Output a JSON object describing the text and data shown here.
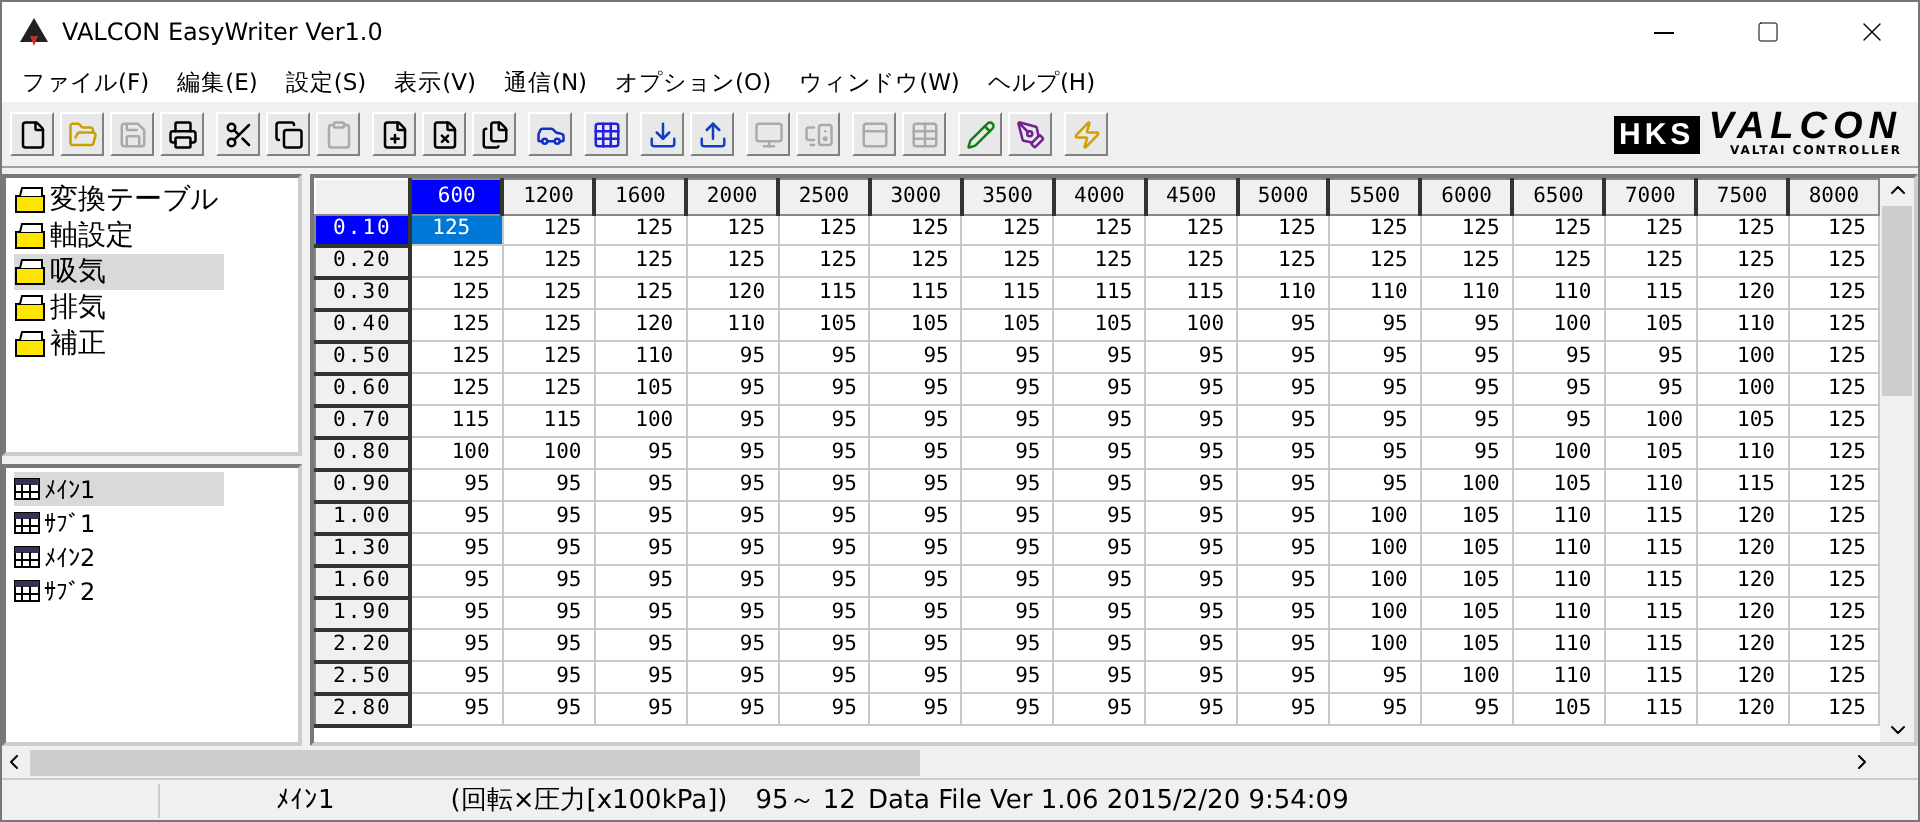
{
  "window": {
    "title": "VALCON EasyWriter Ver1.0"
  },
  "menu": [
    "ファイル(F)",
    "編集(E)",
    "設定(S)",
    "表示(V)",
    "通信(N)",
    "オプション(O)",
    "ウィンドウ(W)",
    "ヘルプ(H)"
  ],
  "toolbar_groups": [
    [
      {
        "disabled": false
      },
      {
        "disabled": false
      },
      {
        "disabled": true
      },
      {
        "disabled": false
      }
    ],
    [
      {
        "disabled": false
      },
      {
        "disabled": false
      },
      {
        "disabled": true
      }
    ],
    [
      {
        "disabled": false
      },
      {
        "disabled": false
      },
      {
        "disabled": false
      }
    ],
    [
      {
        "disabled": false
      }
    ],
    [
      {
        "disabled": false
      }
    ],
    [
      {
        "disabled": false
      },
      {
        "disabled": false
      }
    ],
    [
      {
        "disabled": true
      },
      {
        "disabled": true
      }
    ],
    [
      {
        "disabled": true
      },
      {
        "disabled": true
      }
    ],
    [
      {
        "disabled": false
      },
      {
        "disabled": false
      }
    ],
    [
      {
        "disabled": false
      }
    ]
  ],
  "logo": {
    "brand": "HKS",
    "product": "VALCON",
    "tagline": "VALTAI CONTROLLER"
  },
  "categories": [
    {
      "label": "変換テーブル",
      "selected": false
    },
    {
      "label": "軸設定",
      "selected": false
    },
    {
      "label": "吸気",
      "selected": true
    },
    {
      "label": "排気",
      "selected": false
    },
    {
      "label": "補正",
      "selected": false
    }
  ],
  "maps": [
    {
      "label": "ﾒｲﾝ1",
      "selected": true
    },
    {
      "label": "ｻﾌﾞ1",
      "selected": false
    },
    {
      "label": "ﾒｲﾝ2",
      "selected": false
    },
    {
      "label": "ｻﾌﾞ2",
      "selected": false
    }
  ],
  "table": {
    "columns": [
      {
        "label": "600",
        "selected": true
      },
      {
        "label": "1200",
        "selected": false
      },
      {
        "label": "1600",
        "selected": false
      },
      {
        "label": "2000",
        "selected": false
      },
      {
        "label": "2500",
        "selected": false
      },
      {
        "label": "3000",
        "selected": false
      },
      {
        "label": "3500",
        "selected": false
      },
      {
        "label": "4000",
        "selected": false
      },
      {
        "label": "4500",
        "selected": false
      },
      {
        "label": "5000",
        "selected": false
      },
      {
        "label": "5500",
        "selected": false
      },
      {
        "label": "6000",
        "selected": false
      },
      {
        "label": "6500",
        "selected": false
      },
      {
        "label": "7000",
        "selected": false
      },
      {
        "label": "7500",
        "selected": false
      },
      {
        "label": "8000",
        "selected": false
      }
    ],
    "rows": [
      {
        "label": "0.10",
        "selected": true,
        "cells": [
          {
            "value": "125",
            "selected": true
          },
          {
            "value": "125",
            "selected": false
          },
          {
            "value": "125",
            "selected": false
          },
          {
            "value": "125",
            "selected": false
          },
          {
            "value": "125",
            "selected": false
          },
          {
            "value": "125",
            "selected": false
          },
          {
            "value": "125",
            "selected": false
          },
          {
            "value": "125",
            "selected": false
          },
          {
            "value": "125",
            "selected": false
          },
          {
            "value": "125",
            "selected": false
          },
          {
            "value": "125",
            "selected": false
          },
          {
            "value": "125",
            "selected": false
          },
          {
            "value": "125",
            "selected": false
          },
          {
            "value": "125",
            "selected": false
          },
          {
            "value": "125",
            "selected": false
          },
          {
            "value": "125",
            "selected": false
          }
        ]
      },
      {
        "label": "0.20",
        "selected": false,
        "cells": [
          {
            "value": "125",
            "selected": false
          },
          {
            "value": "125",
            "selected": false
          },
          {
            "value": "125",
            "selected": false
          },
          {
            "value": "125",
            "selected": false
          },
          {
            "value": "125",
            "selected": false
          },
          {
            "value": "125",
            "selected": false
          },
          {
            "value": "125",
            "selected": false
          },
          {
            "value": "125",
            "selected": false
          },
          {
            "value": "125",
            "selected": false
          },
          {
            "value": "125",
            "selected": false
          },
          {
            "value": "125",
            "selected": false
          },
          {
            "value": "125",
            "selected": false
          },
          {
            "value": "125",
            "selected": false
          },
          {
            "value": "125",
            "selected": false
          },
          {
            "value": "125",
            "selected": false
          },
          {
            "value": "125",
            "selected": false
          }
        ]
      },
      {
        "label": "0.30",
        "selected": false,
        "cells": [
          {
            "value": "125",
            "selected": false
          },
          {
            "value": "125",
            "selected": false
          },
          {
            "value": "125",
            "selected": false
          },
          {
            "value": "120",
            "selected": false
          },
          {
            "value": "115",
            "selected": false
          },
          {
            "value": "115",
            "selected": false
          },
          {
            "value": "115",
            "selected": false
          },
          {
            "value": "115",
            "selected": false
          },
          {
            "value": "115",
            "selected": false
          },
          {
            "value": "110",
            "selected": false
          },
          {
            "value": "110",
            "selected": false
          },
          {
            "value": "110",
            "selected": false
          },
          {
            "value": "110",
            "selected": false
          },
          {
            "value": "115",
            "selected": false
          },
          {
            "value": "120",
            "selected": false
          },
          {
            "value": "125",
            "selected": false
          }
        ]
      },
      {
        "label": "0.40",
        "selected": false,
        "cells": [
          {
            "value": "125",
            "selected": false
          },
          {
            "value": "125",
            "selected": false
          },
          {
            "value": "120",
            "selected": false
          },
          {
            "value": "110",
            "selected": false
          },
          {
            "value": "105",
            "selected": false
          },
          {
            "value": "105",
            "selected": false
          },
          {
            "value": "105",
            "selected": false
          },
          {
            "value": "105",
            "selected": false
          },
          {
            "value": "100",
            "selected": false
          },
          {
            "value": "95",
            "selected": false
          },
          {
            "value": "95",
            "selected": false
          },
          {
            "value": "95",
            "selected": false
          },
          {
            "value": "100",
            "selected": false
          },
          {
            "value": "105",
            "selected": false
          },
          {
            "value": "110",
            "selected": false
          },
          {
            "value": "125",
            "selected": false
          }
        ]
      },
      {
        "label": "0.50",
        "selected": false,
        "cells": [
          {
            "value": "125",
            "selected": false
          },
          {
            "value": "125",
            "selected": false
          },
          {
            "value": "110",
            "selected": false
          },
          {
            "value": "95",
            "selected": false
          },
          {
            "value": "95",
            "selected": false
          },
          {
            "value": "95",
            "selected": false
          },
          {
            "value": "95",
            "selected": false
          },
          {
            "value": "95",
            "selected": false
          },
          {
            "value": "95",
            "selected": false
          },
          {
            "value": "95",
            "selected": false
          },
          {
            "value": "95",
            "selected": false
          },
          {
            "value": "95",
            "selected": false
          },
          {
            "value": "95",
            "selected": false
          },
          {
            "value": "95",
            "selected": false
          },
          {
            "value": "100",
            "selected": false
          },
          {
            "value": "125",
            "selected": false
          }
        ]
      },
      {
        "label": "0.60",
        "selected": false,
        "cells": [
          {
            "value": "125",
            "selected": false
          },
          {
            "value": "125",
            "selected": false
          },
          {
            "value": "105",
            "selected": false
          },
          {
            "value": "95",
            "selected": false
          },
          {
            "value": "95",
            "selected": false
          },
          {
            "value": "95",
            "selected": false
          },
          {
            "value": "95",
            "selected": false
          },
          {
            "value": "95",
            "selected": false
          },
          {
            "value": "95",
            "selected": false
          },
          {
            "value": "95",
            "selected": false
          },
          {
            "value": "95",
            "selected": false
          },
          {
            "value": "95",
            "selected": false
          },
          {
            "value": "95",
            "selected": false
          },
          {
            "value": "95",
            "selected": false
          },
          {
            "value": "100",
            "selected": false
          },
          {
            "value": "125",
            "selected": false
          }
        ]
      },
      {
        "label": "0.70",
        "selected": false,
        "cells": [
          {
            "value": "115",
            "selected": false
          },
          {
            "value": "115",
            "selected": false
          },
          {
            "value": "100",
            "selected": false
          },
          {
            "value": "95",
            "selected": false
          },
          {
            "value": "95",
            "selected": false
          },
          {
            "value": "95",
            "selected": false
          },
          {
            "value": "95",
            "selected": false
          },
          {
            "value": "95",
            "selected": false
          },
          {
            "value": "95",
            "selected": false
          },
          {
            "value": "95",
            "selected": false
          },
          {
            "value": "95",
            "selected": false
          },
          {
            "value": "95",
            "selected": false
          },
          {
            "value": "95",
            "selected": false
          },
          {
            "value": "100",
            "selected": false
          },
          {
            "value": "105",
            "selected": false
          },
          {
            "value": "125",
            "selected": false
          }
        ]
      },
      {
        "label": "0.80",
        "selected": false,
        "cells": [
          {
            "value": "100",
            "selected": false
          },
          {
            "value": "100",
            "selected": false
          },
          {
            "value": "95",
            "selected": false
          },
          {
            "value": "95",
            "selected": false
          },
          {
            "value": "95",
            "selected": false
          },
          {
            "value": "95",
            "selected": false
          },
          {
            "value": "95",
            "selected": false
          },
          {
            "value": "95",
            "selected": false
          },
          {
            "value": "95",
            "selected": false
          },
          {
            "value": "95",
            "selected": false
          },
          {
            "value": "95",
            "selected": false
          },
          {
            "value": "95",
            "selected": false
          },
          {
            "value": "100",
            "selected": false
          },
          {
            "value": "105",
            "selected": false
          },
          {
            "value": "110",
            "selected": false
          },
          {
            "value": "125",
            "selected": false
          }
        ]
      },
      {
        "label": "0.90",
        "selected": false,
        "cells": [
          {
            "value": "95",
            "selected": false
          },
          {
            "value": "95",
            "selected": false
          },
          {
            "value": "95",
            "selected": false
          },
          {
            "value": "95",
            "selected": false
          },
          {
            "value": "95",
            "selected": false
          },
          {
            "value": "95",
            "selected": false
          },
          {
            "value": "95",
            "selected": false
          },
          {
            "value": "95",
            "selected": false
          },
          {
            "value": "95",
            "selected": false
          },
          {
            "value": "95",
            "selected": false
          },
          {
            "value": "95",
            "selected": false
          },
          {
            "value": "100",
            "selected": false
          },
          {
            "value": "105",
            "selected": false
          },
          {
            "value": "110",
            "selected": false
          },
          {
            "value": "115",
            "selected": false
          },
          {
            "value": "125",
            "selected": false
          }
        ]
      },
      {
        "label": "1.00",
        "selected": false,
        "cells": [
          {
            "value": "95",
            "selected": false
          },
          {
            "value": "95",
            "selected": false
          },
          {
            "value": "95",
            "selected": false
          },
          {
            "value": "95",
            "selected": false
          },
          {
            "value": "95",
            "selected": false
          },
          {
            "value": "95",
            "selected": false
          },
          {
            "value": "95",
            "selected": false
          },
          {
            "value": "95",
            "selected": false
          },
          {
            "value": "95",
            "selected": false
          },
          {
            "value": "95",
            "selected": false
          },
          {
            "value": "100",
            "selected": false
          },
          {
            "value": "105",
            "selected": false
          },
          {
            "value": "110",
            "selected": false
          },
          {
            "value": "115",
            "selected": false
          },
          {
            "value": "120",
            "selected": false
          },
          {
            "value": "125",
            "selected": false
          }
        ]
      },
      {
        "label": "1.30",
        "selected": false,
        "cells": [
          {
            "value": "95",
            "selected": false
          },
          {
            "value": "95",
            "selected": false
          },
          {
            "value": "95",
            "selected": false
          },
          {
            "value": "95",
            "selected": false
          },
          {
            "value": "95",
            "selected": false
          },
          {
            "value": "95",
            "selected": false
          },
          {
            "value": "95",
            "selected": false
          },
          {
            "value": "95",
            "selected": false
          },
          {
            "value": "95",
            "selected": false
          },
          {
            "value": "95",
            "selected": false
          },
          {
            "value": "100",
            "selected": false
          },
          {
            "value": "105",
            "selected": false
          },
          {
            "value": "110",
            "selected": false
          },
          {
            "value": "115",
            "selected": false
          },
          {
            "value": "120",
            "selected": false
          },
          {
            "value": "125",
            "selected": false
          }
        ]
      },
      {
        "label": "1.60",
        "selected": false,
        "cells": [
          {
            "value": "95",
            "selected": false
          },
          {
            "value": "95",
            "selected": false
          },
          {
            "value": "95",
            "selected": false
          },
          {
            "value": "95",
            "selected": false
          },
          {
            "value": "95",
            "selected": false
          },
          {
            "value": "95",
            "selected": false
          },
          {
            "value": "95",
            "selected": false
          },
          {
            "value": "95",
            "selected": false
          },
          {
            "value": "95",
            "selected": false
          },
          {
            "value": "95",
            "selected": false
          },
          {
            "value": "100",
            "selected": false
          },
          {
            "value": "105",
            "selected": false
          },
          {
            "value": "110",
            "selected": false
          },
          {
            "value": "115",
            "selected": false
          },
          {
            "value": "120",
            "selected": false
          },
          {
            "value": "125",
            "selected": false
          }
        ]
      },
      {
        "label": "1.90",
        "selected": false,
        "cells": [
          {
            "value": "95",
            "selected": false
          },
          {
            "value": "95",
            "selected": false
          },
          {
            "value": "95",
            "selected": false
          },
          {
            "value": "95",
            "selected": false
          },
          {
            "value": "95",
            "selected": false
          },
          {
            "value": "95",
            "selected": false
          },
          {
            "value": "95",
            "selected": false
          },
          {
            "value": "95",
            "selected": false
          },
          {
            "value": "95",
            "selected": false
          },
          {
            "value": "95",
            "selected": false
          },
          {
            "value": "100",
            "selected": false
          },
          {
            "value": "105",
            "selected": false
          },
          {
            "value": "110",
            "selected": false
          },
          {
            "value": "115",
            "selected": false
          },
          {
            "value": "120",
            "selected": false
          },
          {
            "value": "125",
            "selected": false
          }
        ]
      },
      {
        "label": "2.20",
        "selected": false,
        "cells": [
          {
            "value": "95",
            "selected": false
          },
          {
            "value": "95",
            "selected": false
          },
          {
            "value": "95",
            "selected": false
          },
          {
            "value": "95",
            "selected": false
          },
          {
            "value": "95",
            "selected": false
          },
          {
            "value": "95",
            "selected": false
          },
          {
            "value": "95",
            "selected": false
          },
          {
            "value": "95",
            "selected": false
          },
          {
            "value": "95",
            "selected": false
          },
          {
            "value": "95",
            "selected": false
          },
          {
            "value": "100",
            "selected": false
          },
          {
            "value": "105",
            "selected": false
          },
          {
            "value": "110",
            "selected": false
          },
          {
            "value": "115",
            "selected": false
          },
          {
            "value": "120",
            "selected": false
          },
          {
            "value": "125",
            "selected": false
          }
        ]
      },
      {
        "label": "2.50",
        "selected": false,
        "cells": [
          {
            "value": "95",
            "selected": false
          },
          {
            "value": "95",
            "selected": false
          },
          {
            "value": "95",
            "selected": false
          },
          {
            "value": "95",
            "selected": false
          },
          {
            "value": "95",
            "selected": false
          },
          {
            "value": "95",
            "selected": false
          },
          {
            "value": "95",
            "selected": false
          },
          {
            "value": "95",
            "selected": false
          },
          {
            "value": "95",
            "selected": false
          },
          {
            "value": "95",
            "selected": false
          },
          {
            "value": "95",
            "selected": false
          },
          {
            "value": "100",
            "selected": false
          },
          {
            "value": "110",
            "selected": false
          },
          {
            "value": "115",
            "selected": false
          },
          {
            "value": "120",
            "selected": false
          },
          {
            "value": "125",
            "selected": false
          }
        ]
      },
      {
        "label": "2.80",
        "selected": false,
        "cells": [
          {
            "value": "95",
            "selected": false
          },
          {
            "value": "95",
            "selected": false
          },
          {
            "value": "95",
            "selected": false
          },
          {
            "value": "95",
            "selected": false
          },
          {
            "value": "95",
            "selected": false
          },
          {
            "value": "95",
            "selected": false
          },
          {
            "value": "95",
            "selected": false
          },
          {
            "value": "95",
            "selected": false
          },
          {
            "value": "95",
            "selected": false
          },
          {
            "value": "95",
            "selected": false
          },
          {
            "value": "95",
            "selected": false
          },
          {
            "value": "95",
            "selected": false
          },
          {
            "value": "105",
            "selected": false
          },
          {
            "value": "115",
            "selected": false
          },
          {
            "value": "120",
            "selected": false
          },
          {
            "value": "125",
            "selected": false
          }
        ]
      }
    ]
  },
  "status_bar": {
    "map": "ﾒｲﾝ1",
    "axes": "(回転×圧力[x100kPa])",
    "range": "95～ 12",
    "file_info": "Data File Ver 1.06  2015/2/20  9:54:09"
  }
}
